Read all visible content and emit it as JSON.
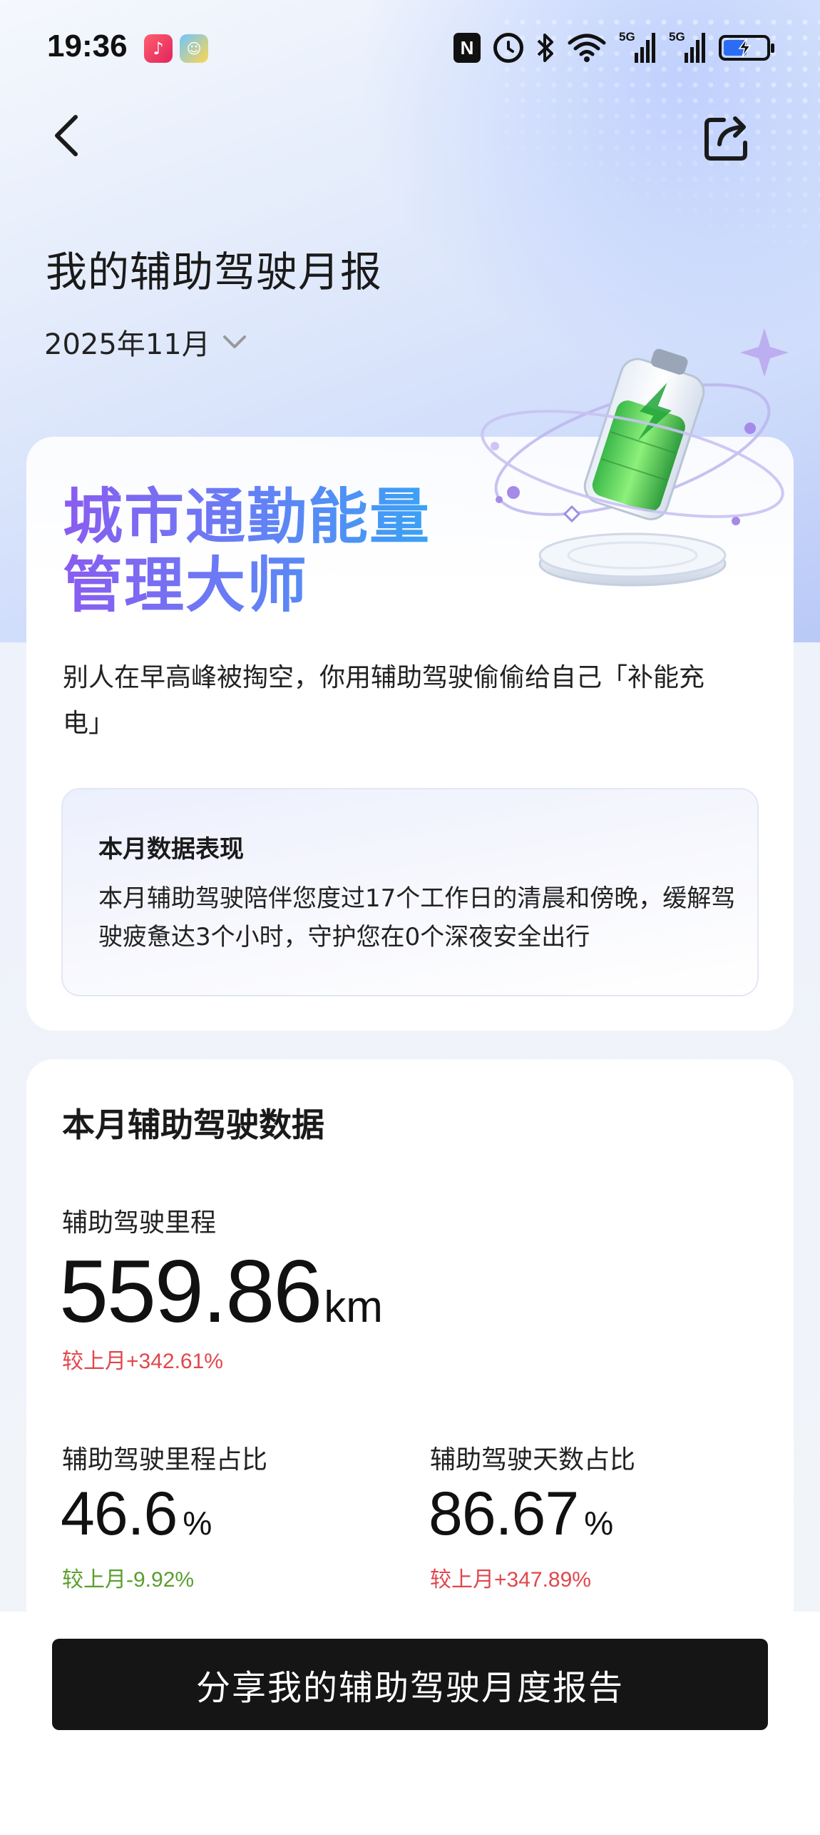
{
  "status_bar": {
    "time": "19:36",
    "signal_1": "5G",
    "signal_2": "5G",
    "icons": [
      "music-app-icon",
      "kids-app-icon",
      "nfc-icon",
      "alarm-icon",
      "bluetooth-icon",
      "wifi-icon",
      "signal-icon",
      "signal-icon",
      "battery-charging-icon"
    ],
    "nfc_label": "N"
  },
  "nav": {
    "back_icon": "chevron-left-icon",
    "share_icon": "share-icon"
  },
  "page": {
    "title": "我的辅助驾驶月报",
    "month": "2025年11月"
  },
  "summary_card": {
    "headline_line1": "城市通勤能量",
    "headline_line2": "管理大师",
    "subtitle": "别人在早高峰被掏空，你用辅助驾驶偷偷给自己「补能充电」",
    "performance": {
      "title": "本月数据表现",
      "text": "本月辅助驾驶陪伴您度过17个工作日的清晨和傍晚，缓解驾驶疲惫达3个小时，守护您在0个深夜安全出行"
    }
  },
  "data_card": {
    "title": "本月辅助驾驶数据",
    "mileage": {
      "label": "辅助驾驶里程",
      "value": "559.86",
      "unit": "km",
      "delta": "较上月+342.61%"
    },
    "mileage_ratio": {
      "label": "辅助驾驶里程占比",
      "value": "46.6",
      "unit": "%",
      "delta": "较上月-9.92%"
    },
    "days_ratio": {
      "label": "辅助驾驶天数占比",
      "value": "86.67",
      "unit": "%",
      "delta": "较上月+347.89%"
    }
  },
  "share_button": {
    "label": "分享我的辅助驾驶月度报告"
  },
  "colors": {
    "headline_gradient_start": "#8a5cf0",
    "headline_gradient_end": "#3aa2f5",
    "delta_up": "#e0474c",
    "delta_down": "#5a9e2e",
    "button_bg": "#151515"
  }
}
